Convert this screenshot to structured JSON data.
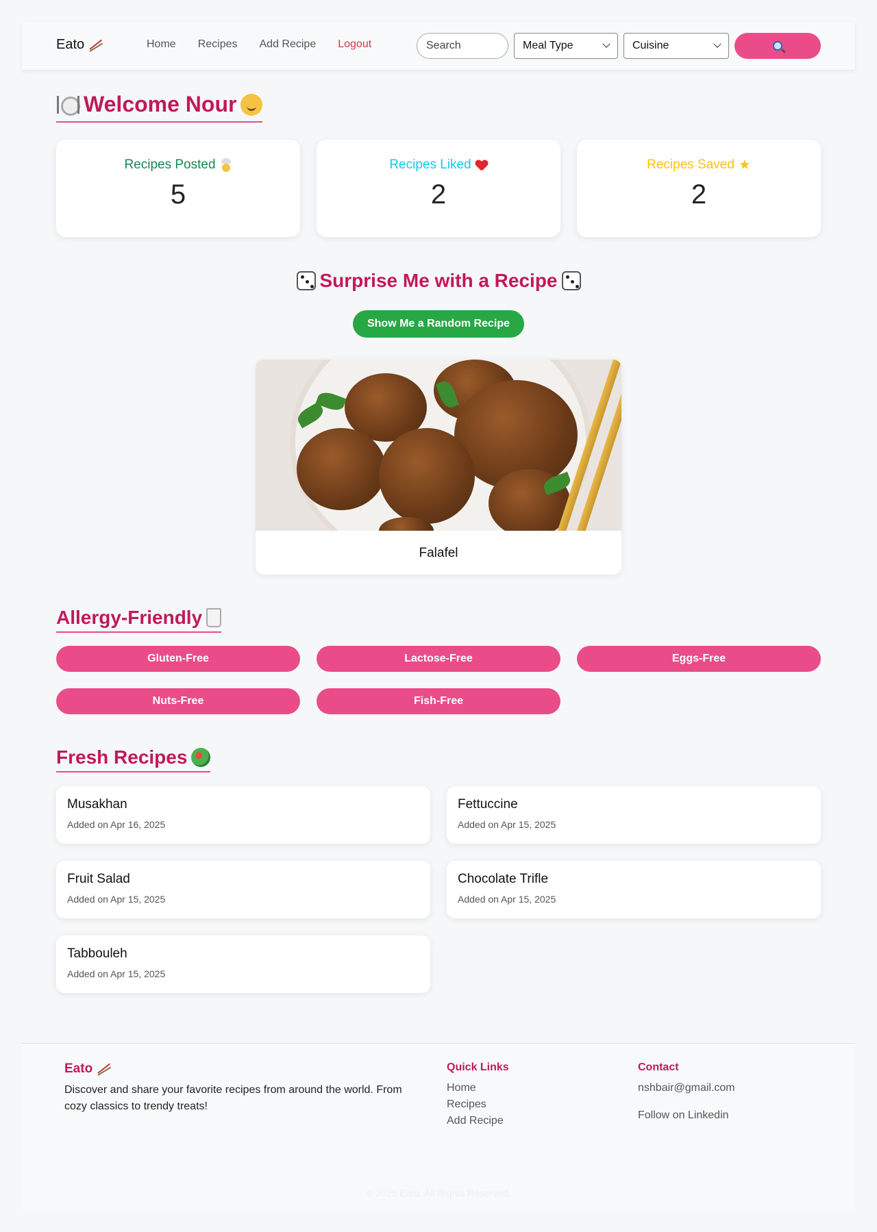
{
  "navbar": {
    "brand": "Eato",
    "links": [
      "Home",
      "Recipes",
      "Add Recipe"
    ],
    "logout": "Logout",
    "search_placeholder": "Search",
    "meal_type": "Meal Type",
    "cuisine": "Cuisine",
    "search_button_icon": "magnifier-icon"
  },
  "welcome": {
    "title": "Welcome Nour"
  },
  "stats": [
    {
      "label": "Recipes Posted",
      "value": "5",
      "icon": "chef-icon",
      "color": "#198754"
    },
    {
      "label": "Recipes Liked",
      "value": "2",
      "icon": "heart-icon",
      "color": "#0dcaf0"
    },
    {
      "label": "Recipes Saved",
      "value": "2",
      "icon": "star-icon",
      "color": "#ffc107"
    }
  ],
  "surprise": {
    "title": "Surprise Me with a Recipe",
    "button": "Show Me a Random Recipe",
    "recipe_title": "Falafel"
  },
  "allergy": {
    "title": "Allergy-Friendly",
    "options": [
      "Gluten-Free",
      "Lactose-Free",
      "Eggs-Free",
      "Nuts-Free",
      "Fish-Free"
    ]
  },
  "fresh": {
    "title": "Fresh Recipes",
    "items": [
      {
        "name": "Musakhan",
        "date": "Added on Apr 16, 2025"
      },
      {
        "name": "Fettuccine",
        "date": "Added on Apr 15, 2025"
      },
      {
        "name": "Fruit Salad",
        "date": "Added on Apr 15, 2025"
      },
      {
        "name": "Chocolate Trifle",
        "date": "Added on Apr 15, 2025"
      },
      {
        "name": "Tabbouleh",
        "date": "Added on Apr 15, 2025"
      }
    ]
  },
  "footer": {
    "brand": "Eato",
    "description": "Discover and share your favorite recipes from around the world. From cozy classics to trendy treats!",
    "quick_links_heading": "Quick Links",
    "quick_links": [
      "Home",
      "Recipes",
      "Add Recipe"
    ],
    "contact_heading": "Contact",
    "email": "nshbair@gmail.com",
    "linkedin": "Follow on Linkedin",
    "copyright": "© 2025 Eato. All Rights Reserved."
  },
  "colors": {
    "accent": "#ea4c89",
    "heading": "#c2185b",
    "success": "#28a745"
  }
}
